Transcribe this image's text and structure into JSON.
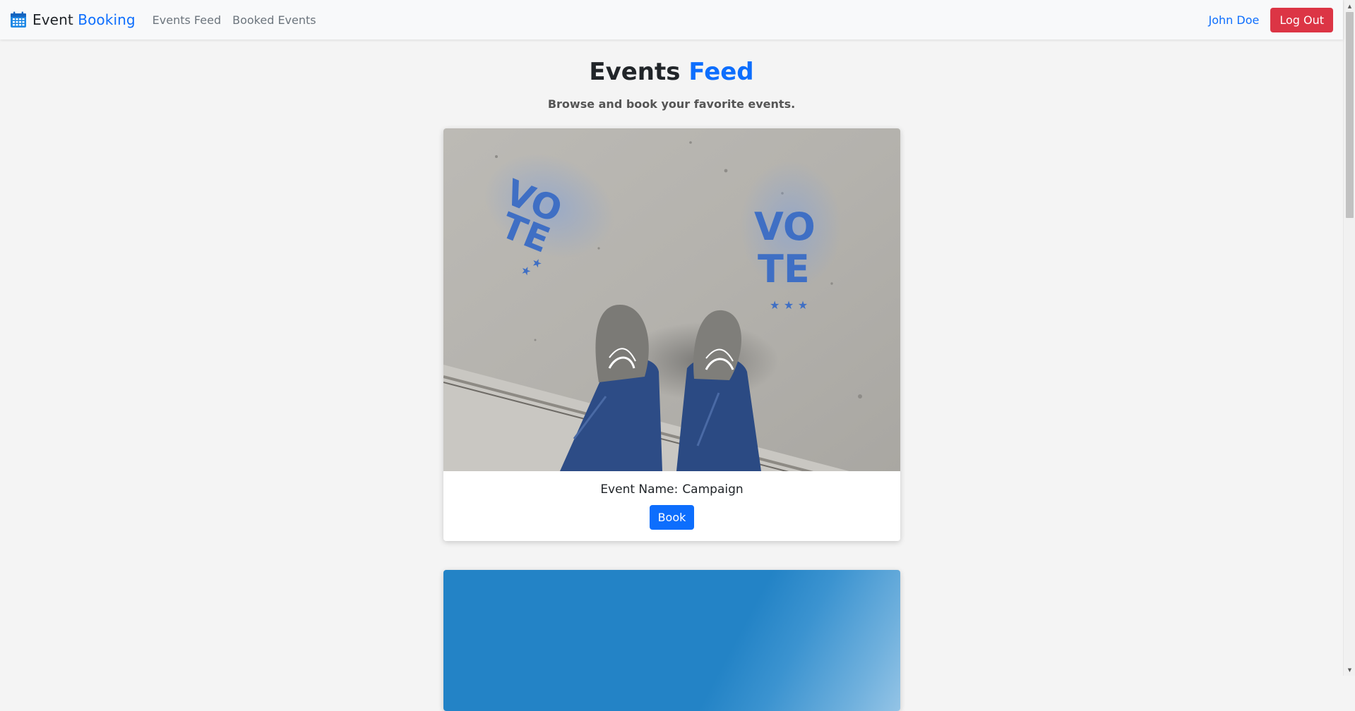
{
  "navbar": {
    "brand_main": "Event",
    "brand_accent": "Booking",
    "links": [
      {
        "label": "Events Feed"
      },
      {
        "label": "Booked Events"
      }
    ],
    "user_name": "John Doe",
    "logout_label": "Log Out"
  },
  "page": {
    "title_main": "Events",
    "title_accent": "Feed",
    "subtitle": "Browse and book your favorite events."
  },
  "events": [
    {
      "label": "Event Name:",
      "name": "Campaign",
      "book_label": "Book"
    },
    {}
  ],
  "colors": {
    "primary": "#0d6efd",
    "danger": "#dc3545",
    "background": "#f4f4f4",
    "navbar": "#f8f9fa"
  },
  "icons": {
    "brand": "calendar-icon"
  }
}
